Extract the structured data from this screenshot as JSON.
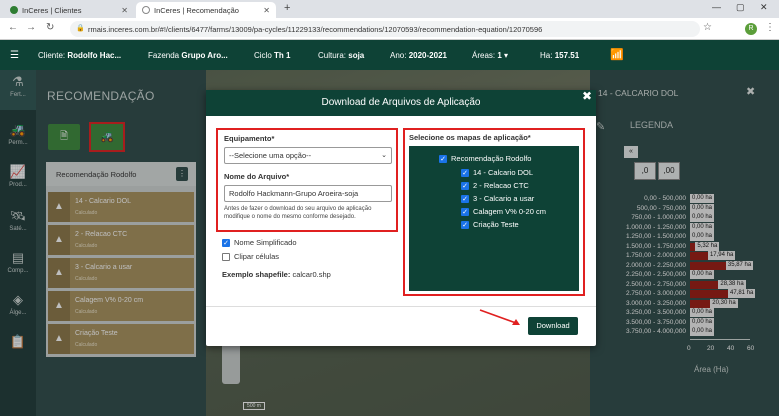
{
  "browser": {
    "tabs": [
      {
        "label": "InCeres | Clientes",
        "active": false
      },
      {
        "label": "InCeres | Recomendação",
        "active": true
      }
    ],
    "new_tab": "+",
    "url": "rmais.inceres.com.br/#!/clients/6477/farms/13009/pa-cycles/11229133/recommendations/12070593/recommendation-equation/12070596",
    "profile_initial": "R",
    "window_controls": {
      "minimize": "—",
      "maximize": "▢",
      "close": "✕"
    }
  },
  "header": {
    "client_label": "Cliente:",
    "client_value": "Rodolfo Hac...",
    "farm_label": "Fazenda",
    "farm_value": "Grupo Aro...",
    "cycle_label": "Ciclo",
    "cycle_value": "Th 1",
    "crop_label": "Cultura:",
    "crop_value": "soja",
    "year_label": "Ano:",
    "year_value": "2020-2021",
    "areas_label": "Áreas:",
    "areas_value": "1",
    "ha_label": "Ha:",
    "ha_value": "157.51"
  },
  "sidebar": {
    "items": [
      {
        "label": "Fert...",
        "icon": "flask-icon"
      },
      {
        "label": "Perm...",
        "icon": "tractor-icon"
      },
      {
        "label": "Prod...",
        "icon": "chart-icon"
      },
      {
        "label": "Saté...",
        "icon": "satellite-icon"
      },
      {
        "label": "Comp...",
        "icon": "compare-icon"
      },
      {
        "label": "Álge...",
        "icon": "layers-icon"
      },
      {
        "label": "",
        "icon": "document-icon"
      }
    ]
  },
  "recommendations": {
    "title": "RECOMENDAÇÃO",
    "list_header": "Recomendação Rodolfo",
    "items": [
      {
        "name": "14 - Calcario DOL",
        "status": "Calculado"
      },
      {
        "name": "2 - Relacao CTC",
        "status": "Calculado"
      },
      {
        "name": "3 - Calcario a usar",
        "status": "Calculado"
      },
      {
        "name": "Calagem V% 0-20 cm",
        "status": "Calculado"
      },
      {
        "name": "Criação Teste",
        "status": "Calculado"
      }
    ]
  },
  "legend_panel": {
    "title": "14 - CALCARIO DOL",
    "legend_label": "LEGENDA",
    "decimal_buttons": [
      ",0",
      ",00"
    ],
    "nav": "«"
  },
  "chart_data": {
    "type": "bar",
    "orientation": "horizontal",
    "categories": [
      "0,00 - 500,000",
      "500,00 - 750,000",
      "750,00 - 1.000,000",
      "1.000,00 - 1.250,000",
      "1.250,00 - 1.500,000",
      "1.500,00 - 1.750,000",
      "1.750,00 - 2.000,000",
      "2.000,00 - 2.250,000",
      "2.250,00 - 2.500,000",
      "2.500,00 - 2.750,000",
      "2.750,00 - 3.000,000",
      "3.000,00 - 3.250,000",
      "3.250,00 - 3.500,000",
      "3.500,00 - 3.750,000",
      "3.750,00 - 4.000,000"
    ],
    "values": [
      0,
      0,
      0,
      0,
      0,
      5.32,
      17.94,
      35.87,
      0,
      28.38,
      47.81,
      20.3,
      0,
      0,
      0
    ],
    "value_labels": [
      "0,00 ha",
      "0,00 ha",
      "0,00 ha",
      "0,00 ha",
      "0,00 ha",
      "5,32 ha",
      "17,94 ha",
      "35,87 ha",
      "0,00 ha",
      "28,38 ha",
      "47,81 ha",
      "20,30 ha",
      "0,00 ha",
      "0,00 ha",
      "0,00 ha"
    ],
    "xlabel": "Área (Ha)",
    "xticks": [
      "0",
      "20",
      "40",
      "60"
    ],
    "xlim": [
      0,
      60
    ],
    "bar_color": "#9b1b12"
  },
  "modal": {
    "title": "Download de Arquivos de Aplicação",
    "close": "✖",
    "equipment_label": "Equipamento*",
    "equipment_value": "--Selecione uma opção--",
    "filename_label": "Nome do Arquivo*",
    "filename_value": "Rodolfo Hackmann-Grupo Aroeira-soja",
    "help_text": "Antes de fazer o download do seu arquivo de aplicação modifique o nome do mesmo conforme desejado.",
    "simplified_name": "Nome Simplificado",
    "simplified_checked": true,
    "clip_cells": "Clipar células",
    "clip_checked": false,
    "shapefile_label": "Exemplo shapefile:",
    "shapefile_value": "calcar0.shp",
    "maps_title": "Selecione os mapas de aplicação*",
    "maps_group": "Recomendação Rodolfo",
    "maps": [
      "14 - Calcario DOL",
      "2 - Relacao CTC",
      "3 - Calcario a usar",
      "Calagem V% 0-20 cm",
      "Criação Teste"
    ],
    "download_button": "Download"
  },
  "map": {
    "scale_label": "500 m"
  },
  "colors": {
    "header": "#0e4236",
    "accent_green": "#3c8a3c",
    "highlight_red": "#e02020",
    "item_brown": "#a8925e"
  }
}
